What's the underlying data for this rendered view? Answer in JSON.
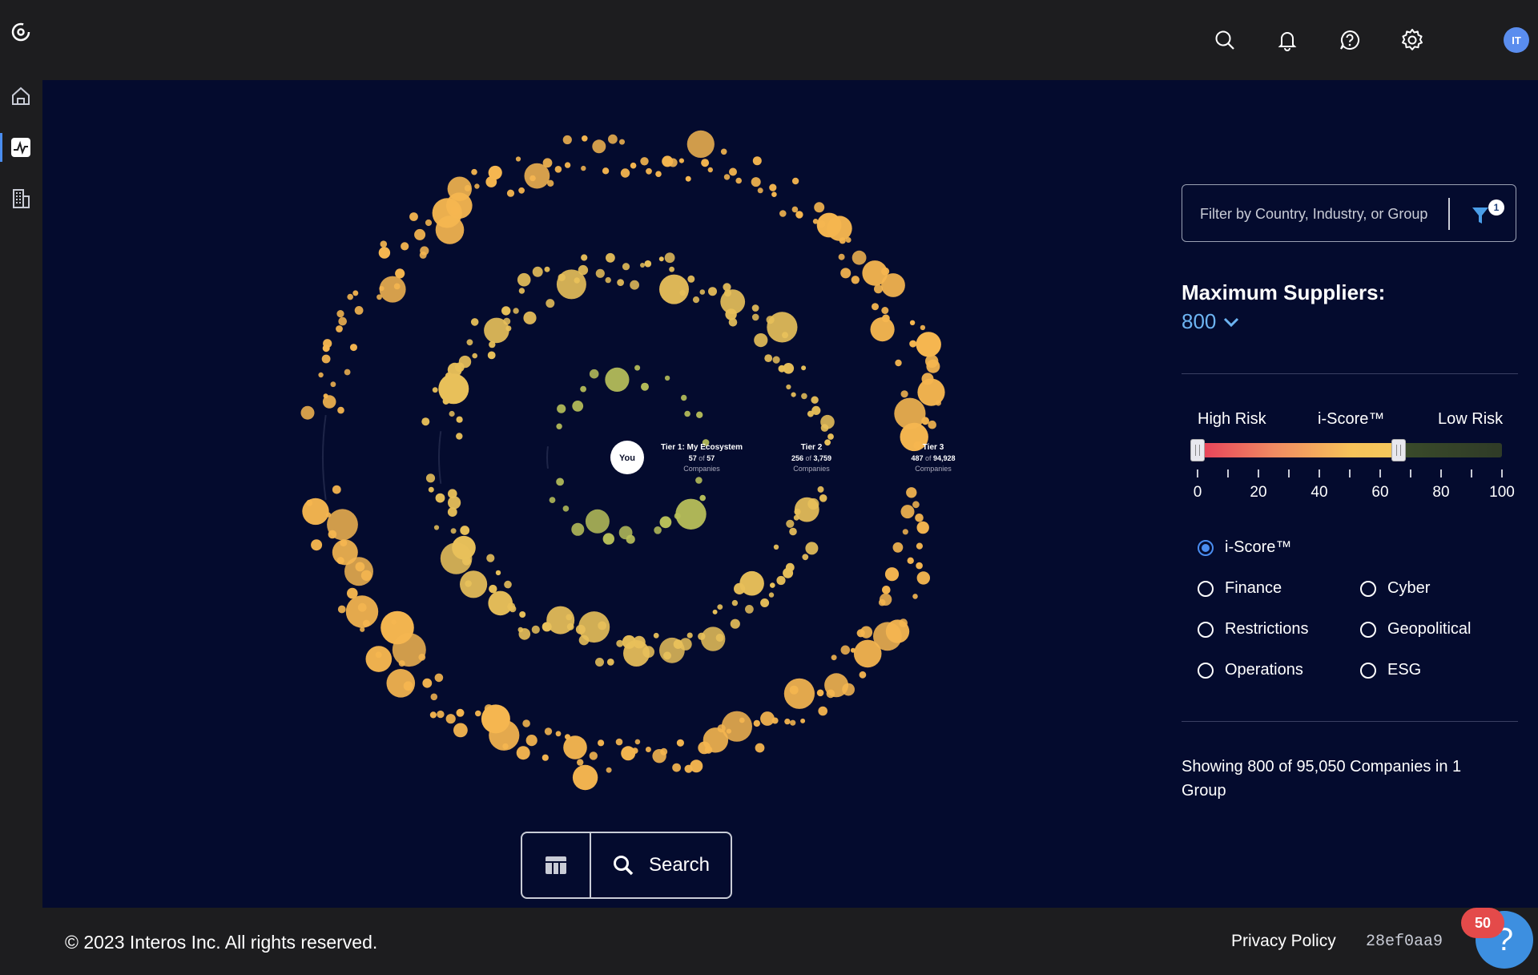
{
  "sidebar": {
    "items": [
      {
        "name": "logo",
        "icon": "logo-icon"
      },
      {
        "name": "home",
        "icon": "home-icon"
      },
      {
        "name": "ecosystem",
        "icon": "activity-icon",
        "active": true
      },
      {
        "name": "companies",
        "icon": "building-icon"
      }
    ]
  },
  "topbar": {
    "icons": [
      "search-icon",
      "bell-icon",
      "help-circle-icon",
      "gear-icon"
    ],
    "avatar_initials": "IT"
  },
  "viz": {
    "center_label": "You",
    "tiers": [
      {
        "title": "Tier 1: My Ecosystem",
        "shown": "57",
        "of_word": "of",
        "total": "57",
        "unit": "Companies"
      },
      {
        "title": "Tier 2",
        "shown": "256",
        "of_word": "of",
        "total": "3,759",
        "unit": "Companies"
      },
      {
        "title": "Tier 3",
        "shown": "487",
        "of_word": "of",
        "total": "94,928",
        "unit": "Companies"
      }
    ],
    "colors": {
      "tier1": "#b7bf5a",
      "tier2": "#e8c05a",
      "tier3": "#f5b650",
      "background": "#040b2e"
    }
  },
  "filter": {
    "placeholder": "Filter by Country, Industry, or Group",
    "badge_count": "1"
  },
  "max_suppliers": {
    "label": "Maximum Suppliers:",
    "value": "800"
  },
  "score_slider": {
    "high_label": "High Risk",
    "center_label": "i-Score™",
    "low_label": "Low Risk",
    "min": 0,
    "max": 100,
    "range_low": 0,
    "range_high": 66,
    "ticks": [
      "0",
      "20",
      "40",
      "60",
      "80",
      "100"
    ]
  },
  "risk_types": [
    {
      "label": "i-Score™",
      "checked": true
    },
    {
      "label": "Finance",
      "checked": false
    },
    {
      "label": "Cyber",
      "checked": false
    },
    {
      "label": "Restrictions",
      "checked": false
    },
    {
      "label": "Geopolitical",
      "checked": false
    },
    {
      "label": "Operations",
      "checked": false
    },
    {
      "label": "ESG",
      "checked": false
    }
  ],
  "summary": {
    "text": "Showing 800 of 95,050 Companies in 1 Group"
  },
  "bottom_bar": {
    "search_label": "Search"
  },
  "footer": {
    "copyright": "© 2023 Interos Inc. All rights reserved.",
    "privacy": "Privacy Policy",
    "build": "28ef0aa9"
  },
  "help": {
    "badge": "50",
    "icon": "?"
  }
}
